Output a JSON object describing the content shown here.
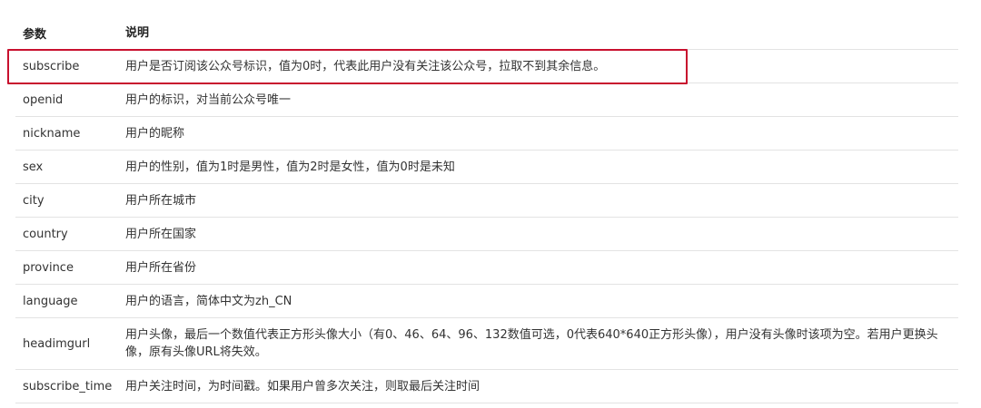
{
  "header": {
    "param": "参数",
    "desc": "说明"
  },
  "rows": [
    {
      "param": "subscribe",
      "desc": "用户是否订阅该公众号标识，值为0时，代表此用户没有关注该公众号，拉取不到其余信息。"
    },
    {
      "param": "openid",
      "desc": "用户的标识，对当前公众号唯一"
    },
    {
      "param": "nickname",
      "desc": "用户的昵称"
    },
    {
      "param": "sex",
      "desc": "用户的性别，值为1时是男性，值为2时是女性，值为0时是未知"
    },
    {
      "param": "city",
      "desc": "用户所在城市"
    },
    {
      "param": "country",
      "desc": "用户所在国家"
    },
    {
      "param": "province",
      "desc": "用户所在省份"
    },
    {
      "param": "language",
      "desc": "用户的语言，简体中文为zh_CN"
    },
    {
      "param": "headimgurl",
      "desc": "用户头像，最后一个数值代表正方形头像大小（有0、46、64、96、132数值可选，0代表640*640正方形头像），用户没有头像时该项为空。若用户更换头像，原有头像URL将失效。"
    },
    {
      "param": "subscribe_time",
      "desc": "用户关注时间，为时间戳。如果用户曾多次关注，则取最后关注时间"
    }
  ],
  "highlight_color": "#c8102e"
}
